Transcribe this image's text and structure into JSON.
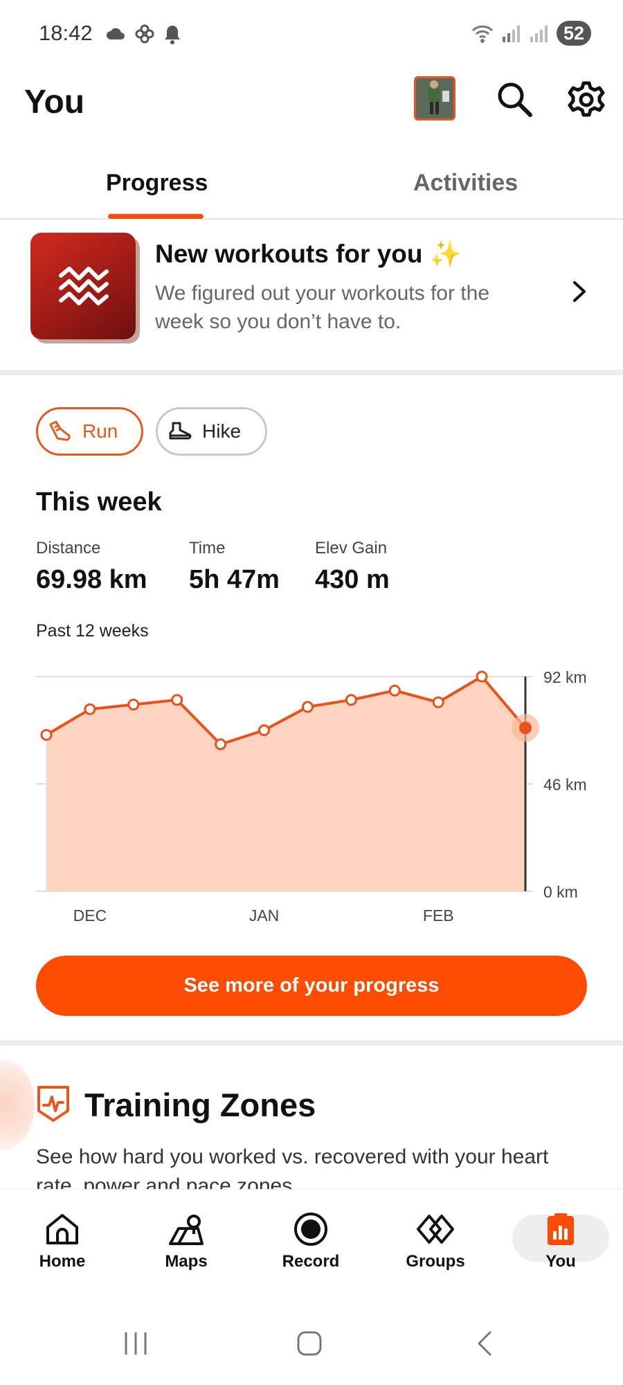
{
  "status_bar": {
    "time": "18:42",
    "battery": "52",
    "icons": [
      "cloud-icon",
      "pinwheel-icon",
      "bell-icon",
      "wifi-icon",
      "signal-icon",
      "signal-icon"
    ]
  },
  "header": {
    "title": "You",
    "icons": [
      "avatar",
      "search-icon",
      "gear-icon"
    ]
  },
  "tabs": [
    {
      "label": "Progress",
      "active": true
    },
    {
      "label": "Activities",
      "active": false
    }
  ],
  "workouts_banner": {
    "title": "New workouts for you ✨",
    "description": "We figured out your workouts for the week so you don’t have to."
  },
  "sport_chips": [
    {
      "label": "Run",
      "selected": true,
      "icon": "running-shoe-icon"
    },
    {
      "label": "Hike",
      "selected": false,
      "icon": "hiking-boot-icon"
    }
  ],
  "this_week": {
    "title": "This week",
    "stats": [
      {
        "label": "Distance",
        "value": "69.98 km"
      },
      {
        "label": "Time",
        "value": "5h 47m"
      },
      {
        "label": "Elev Gain",
        "value": "430 m"
      }
    ],
    "period_label": "Past 12 weeks"
  },
  "chart_data": {
    "type": "area",
    "x": [
      1,
      2,
      3,
      4,
      5,
      6,
      7,
      8,
      9,
      10,
      11,
      12
    ],
    "values": [
      67,
      78,
      80,
      82,
      63,
      69,
      79,
      82,
      86,
      81,
      92,
      70
    ],
    "x_tick_labels": [
      {
        "label": "DEC",
        "week": 2
      },
      {
        "label": "JAN",
        "week": 6
      },
      {
        "label": "FEB",
        "week": 10
      }
    ],
    "y_ticks": [
      {
        "value": 92,
        "label": "92 km"
      },
      {
        "value": 46,
        "label": "46 km"
      },
      {
        "value": 0,
        "label": "0 km"
      }
    ],
    "ylim": [
      0,
      92
    ],
    "highlighted_week": 12,
    "colors": {
      "line": "#e8521a",
      "fill": "#fdd4c0",
      "grid": "#dddddd"
    }
  },
  "cta": {
    "label": "See more of your progress"
  },
  "training_zones": {
    "title": "Training Zones",
    "description": "See how hard you worked vs. recovered with your heart rate, power and pace zones."
  },
  "bottom_nav": [
    {
      "label": "Home",
      "icon": "home-icon",
      "active": false
    },
    {
      "label": "Maps",
      "icon": "map-icon",
      "active": false
    },
    {
      "label": "Record",
      "icon": "record-icon",
      "active": false
    },
    {
      "label": "Groups",
      "icon": "groups-icon",
      "active": false
    },
    {
      "label": "You",
      "icon": "you-chart-icon",
      "active": true
    }
  ],
  "system_nav": [
    "recents-icon",
    "home-circle-icon",
    "back-icon"
  ],
  "colors": {
    "accent": "#fc4c02"
  }
}
